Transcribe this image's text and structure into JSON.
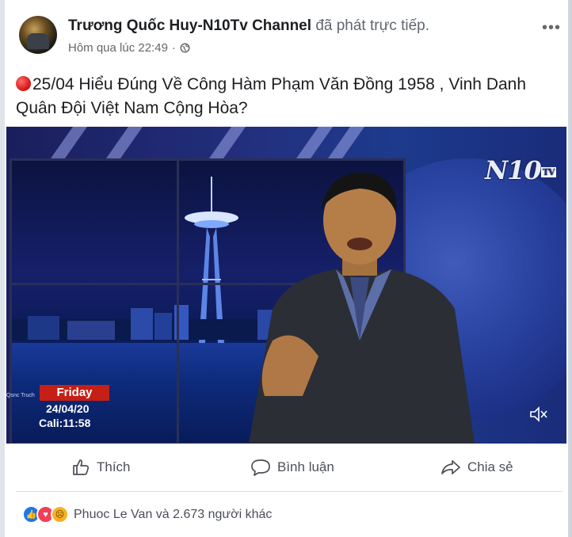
{
  "post": {
    "author": "Trương Quốc Huy-N10Tv Channel",
    "action": "đã phát trực tiếp.",
    "time": "Hôm qua lúc 22:49",
    "time_separator": "·",
    "privacy_icon": "globe-icon",
    "more_label": "•••",
    "text": "25/04 Hiểu Đúng Về Công Hàm Phạm Văn Đồng 1958 , Vinh Danh Quân Đội Việt Nam Cộng Hòa?"
  },
  "video": {
    "channel_logo": "N10",
    "logo_tag": "TV",
    "brand_small": "Qsnc Truch",
    "day": "Friday",
    "date": "24/04/20",
    "location_time": "Cali:11:58",
    "mute_icon": "speaker-muted-icon"
  },
  "actions": {
    "like_label": "Thích",
    "comment_label": "Bình luận",
    "share_label": "Chia sẻ"
  },
  "reactions": {
    "icons": [
      "like-icon",
      "love-icon",
      "sad-icon"
    ],
    "summary": "Phuoc Le Van và 2.673 người khác"
  },
  "colors": {
    "brand_red": "#c51f16",
    "facebook_blue": "#1877f2",
    "love_red": "#f33e58",
    "sad_yellow": "#f7b125"
  }
}
